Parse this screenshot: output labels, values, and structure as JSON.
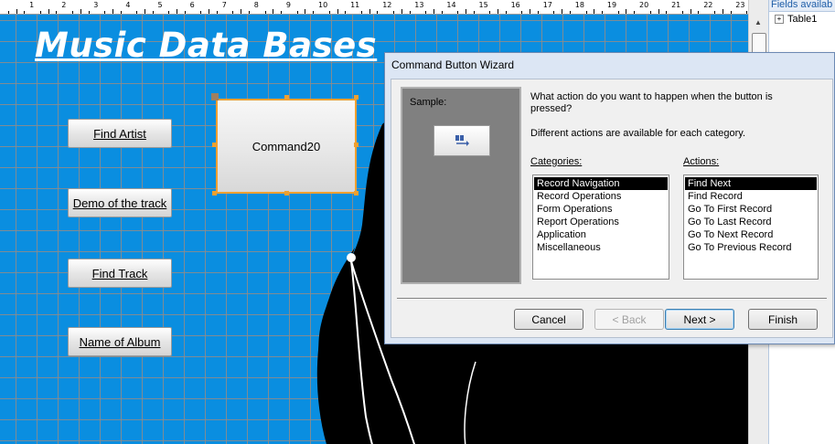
{
  "ruler": {
    "labels": [
      "1",
      "2",
      "3",
      "4",
      "5",
      "6",
      "7",
      "8",
      "9",
      "10",
      "11",
      "12",
      "13",
      "14",
      "15",
      "16",
      "17",
      "18",
      "19",
      "20",
      "21",
      "22",
      "23"
    ]
  },
  "form": {
    "title": "Music Data Bases",
    "buttons": [
      {
        "label": "Find Artist"
      },
      {
        "label": "Demo of the track"
      },
      {
        "label": "Find Track"
      },
      {
        "label": "Name of Album"
      }
    ],
    "command_button": "Command20",
    "background_color": "#0a8ee0",
    "selection_color": "#f0a030"
  },
  "field_list": {
    "header": "Fields availab",
    "items": [
      {
        "label": "Table1"
      }
    ]
  },
  "wizard": {
    "title": "Command Button Wizard",
    "sample_label": "Sample:",
    "question": "What action do you want to happen when the button is pressed?",
    "hint": "Different actions are available for each category.",
    "categories_label": "Categories:",
    "actions_label": "Actions:",
    "categories": [
      {
        "label": "Record Navigation"
      },
      {
        "label": "Record Operations"
      },
      {
        "label": "Form Operations"
      },
      {
        "label": "Report Operations"
      },
      {
        "label": "Application"
      },
      {
        "label": "Miscellaneous"
      }
    ],
    "selected_category": "Record Navigation",
    "actions": [
      {
        "label": "Find Next"
      },
      {
        "label": "Find Record"
      },
      {
        "label": "Go To First Record"
      },
      {
        "label": "Go To Last Record"
      },
      {
        "label": "Go To Next Record"
      },
      {
        "label": "Go To Previous Record"
      }
    ],
    "selected_action": "Find Next",
    "buttons": {
      "cancel": "Cancel",
      "back": "< Back",
      "next": "Next >",
      "finish": "Finish"
    }
  }
}
